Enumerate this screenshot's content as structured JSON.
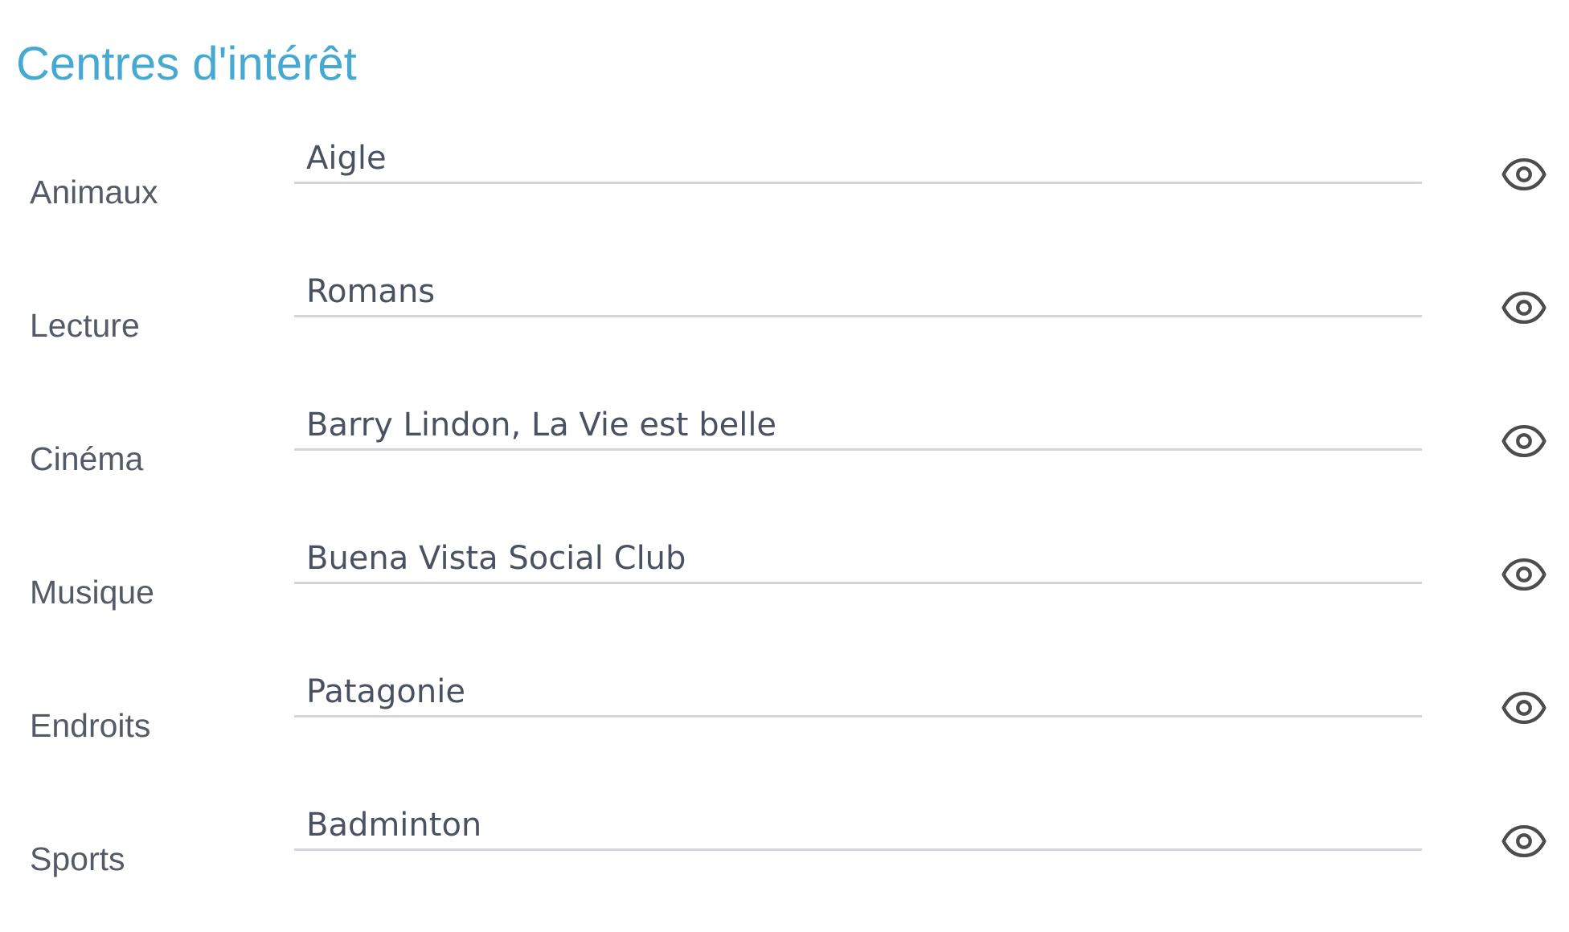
{
  "section": {
    "title": "Centres d'intérêt"
  },
  "colors": {
    "title": "#45a9d1",
    "label": "#555b66",
    "value": "#4a5262",
    "underline": "#d3d5da",
    "icon": "#4d4d4d"
  },
  "fields": [
    {
      "label": "Animaux",
      "value": "Aigle",
      "icon": "eye-icon"
    },
    {
      "label": "Lecture",
      "value": "Romans",
      "icon": "eye-icon"
    },
    {
      "label": "Cinéma",
      "value": "Barry Lindon, La Vie est belle",
      "icon": "eye-icon"
    },
    {
      "label": "Musique",
      "value": "Buena Vista Social Club",
      "icon": "eye-icon"
    },
    {
      "label": "Endroits",
      "value": "Patagonie",
      "icon": "eye-icon"
    },
    {
      "label": "Sports",
      "value": "Badminton",
      "icon": "eye-icon"
    }
  ]
}
